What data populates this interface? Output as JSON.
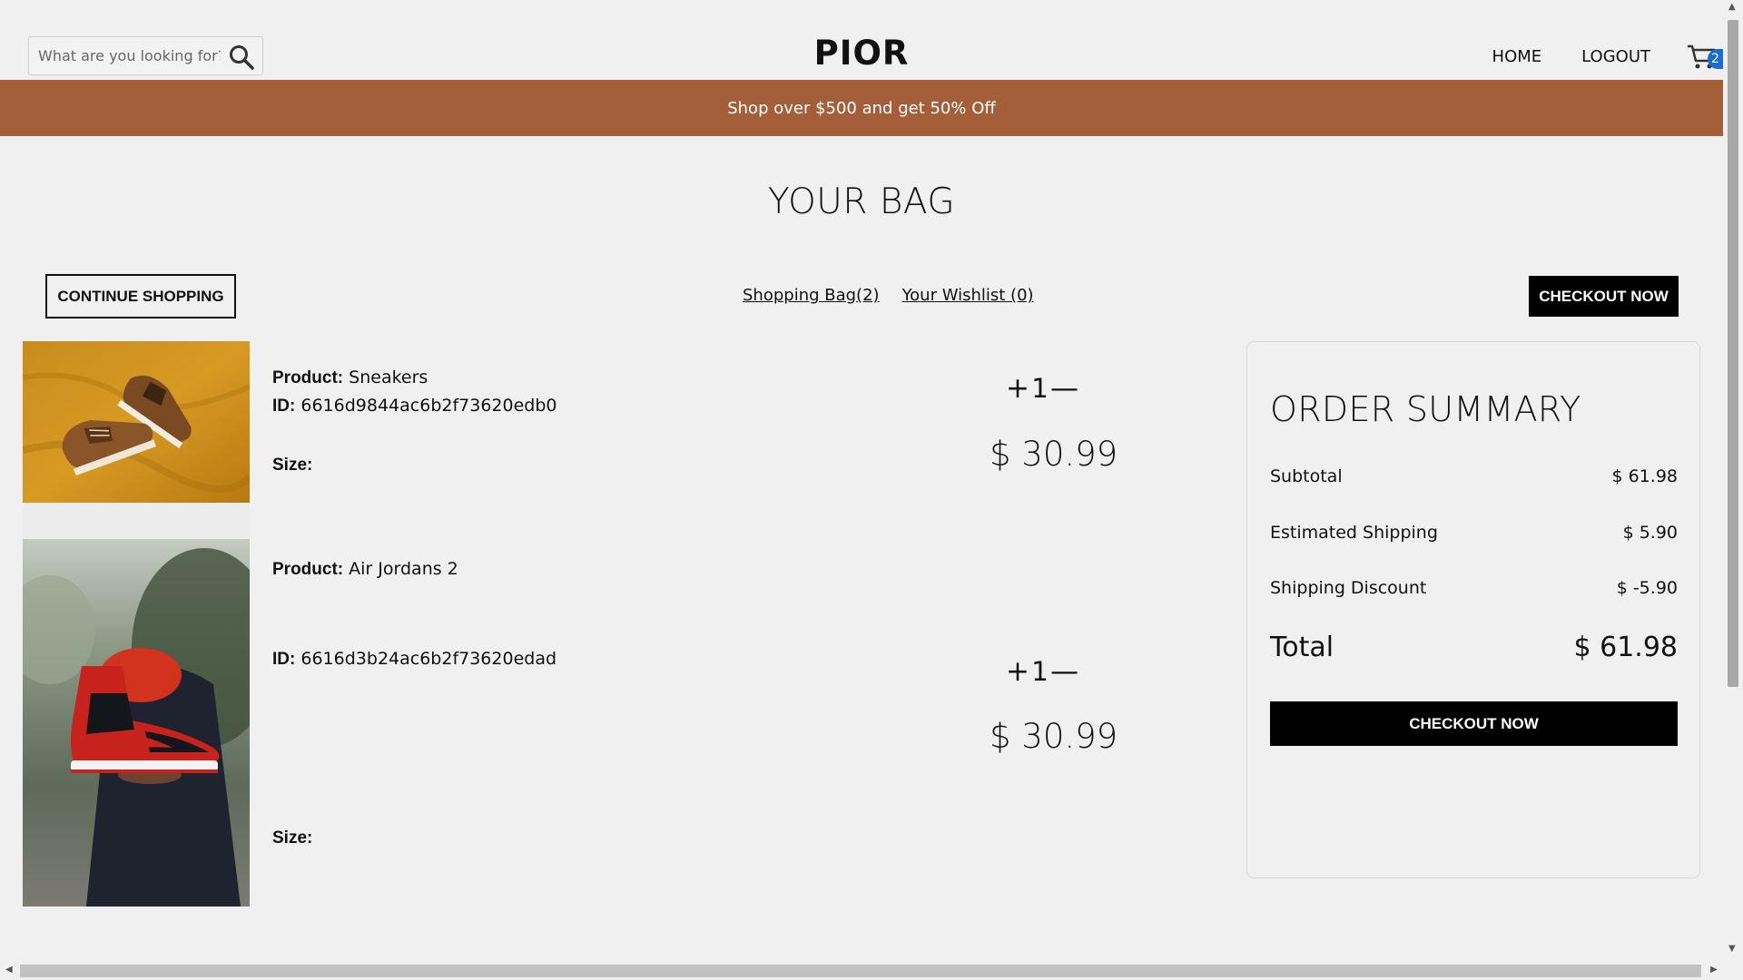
{
  "header": {
    "search_placeholder": "What are you looking for?",
    "logo": "PIOR",
    "nav": [
      "HOME",
      "LOGOUT"
    ],
    "cart_count": "2"
  },
  "promo": "Shop over $500 and get 50% Off",
  "page_title": "YOUR BAG",
  "actions": {
    "continue_label": "CONTINUE SHOPPING",
    "bag_link": "Shopping Bag(2)",
    "wishlist_link": "Your Wishlist (0)",
    "checkout_label": "CHECKOUT NOW"
  },
  "labels": {
    "product": "Product:",
    "id": "ID:",
    "size": "Size:"
  },
  "products": [
    {
      "name": "Sneakers",
      "id": "6616d9844ac6b2f73620edb0",
      "qty": "1",
      "price": "$ 30.99"
    },
    {
      "name": "Air Jordans 2",
      "id": "6616d3b24ac6b2f73620edad",
      "qty": "1",
      "price": "$ 30.99"
    }
  ],
  "summary": {
    "title": "ORDER SUMMARY",
    "rows": [
      {
        "label": "Subtotal",
        "value": "$ 61.98"
      },
      {
        "label": "Estimated Shipping",
        "value": "$ 5.90"
      },
      {
        "label": "Shipping Discount",
        "value": "$ -5.90"
      }
    ],
    "total_label": "Total",
    "total_value": "$ 61.98",
    "checkout_label": "CHECKOUT NOW"
  },
  "colors": {
    "promo_bg": "#a45f3a",
    "page_bg": "#f0f0f0",
    "badge": "#1e6bd6"
  }
}
